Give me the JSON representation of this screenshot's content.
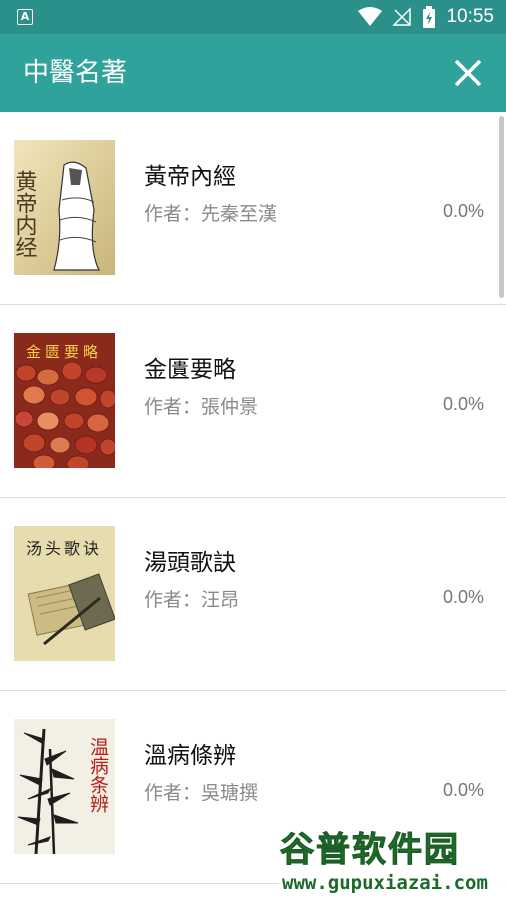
{
  "status_bar": {
    "time": "10:55",
    "notification_letter": "A"
  },
  "toolbar": {
    "title": "中醫名著"
  },
  "books": [
    {
      "title": "黃帝內經",
      "author": "作者：先秦至漢",
      "progress": "0.0%",
      "cover_text": "黄帝内经"
    },
    {
      "title": "金匱要略",
      "author": "作者：張仲景",
      "progress": "0.0%",
      "cover_text": "金匮要略"
    },
    {
      "title": "湯頭歌訣",
      "author": "作者：汪昂",
      "progress": "0.0%",
      "cover_text": "汤头歌诀"
    },
    {
      "title": "溫病條辨",
      "author": "作者：吳瑭撰",
      "progress": "0.0%",
      "cover_text": "温病条辨"
    }
  ],
  "watermark": {
    "name": "谷普软件园",
    "url": "www.gupuxiazai.com"
  },
  "colors": {
    "statusbar": "#2b8f8a",
    "toolbar": "#2fa39b"
  }
}
